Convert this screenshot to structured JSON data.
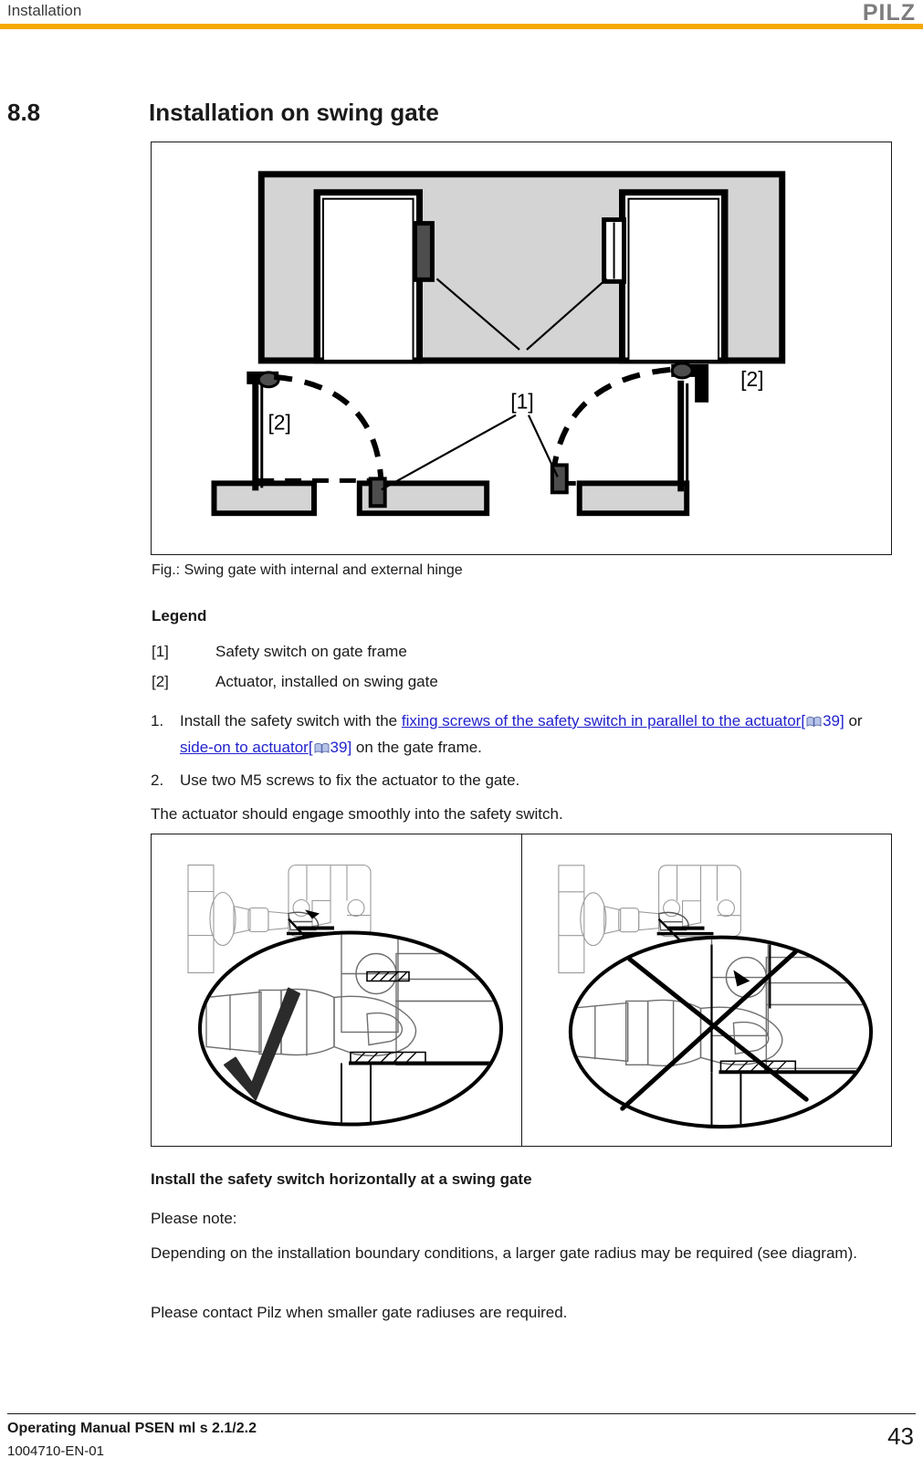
{
  "header": {
    "title": "Installation",
    "brand": "PILZ",
    "rule_color": "#f5a800"
  },
  "section": {
    "number": "8.8",
    "title": "Installation on swing gate"
  },
  "figure": {
    "caption": "Fig.: Swing gate with internal and external hinge",
    "callouts": {
      "switch": "[1]",
      "actuator_left": "[2]",
      "actuator_right": "[2]"
    }
  },
  "legend": {
    "title": "Legend",
    "items": [
      {
        "key": "[1]",
        "value": "Safety switch on gate frame"
      },
      {
        "key": "[2]",
        "value": "Actuator, installed on swing gate"
      }
    ]
  },
  "steps": [
    {
      "number": "1.",
      "prefix": "Install the safety switch with the ",
      "link1": "fixing screws of the safety switch in parallel to the actuator",
      "ref1_open": "[",
      "ref1_page": "39",
      "ref1_close": "]",
      "middle": " or ",
      "link2": "side-on to actuator",
      "ref2_open": "[",
      "ref2_page": "39",
      "ref2_close": "]",
      "suffix": " on the gate frame."
    },
    {
      "number": "2.",
      "text": "Use two M5 screws to fix the actuator to the gate."
    }
  ],
  "paragraphs": {
    "engage": "The actuator should engage smoothly into the safety switch.",
    "note_label": "Please note:",
    "depending": "Depending on the installation boundary conditions, a larger gate radius may be required (see diagram).",
    "contact": "Please contact Pilz when smaller gate radiuses are required."
  },
  "subheads": {
    "horizontal": "Install the safety switch horizontally at a swing gate"
  },
  "comparison": {
    "correct_mark": "check-mark",
    "incorrect_mark": "cross-mark"
  },
  "footer": {
    "manual": "Operating Manual PSEN ml s 2.1/2.2",
    "doc_number": "1004710-EN-01",
    "page": "43"
  },
  "colors": {
    "accent": "#f5a800",
    "link": "#2222cc",
    "wall_fill": "#d4d4d4",
    "switch_fill": "#4d4d4d"
  }
}
